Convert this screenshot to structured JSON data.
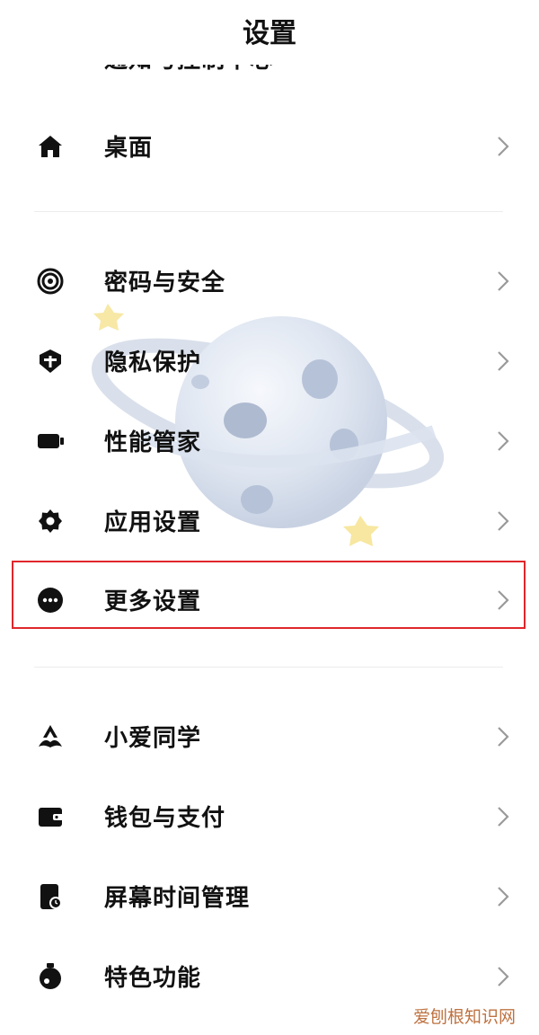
{
  "header": {
    "title": "设置"
  },
  "clipped_item": {
    "label": "通知与控制中心"
  },
  "groups": [
    {
      "items": [
        {
          "label": "桌面",
          "icon": "home-icon"
        }
      ]
    },
    {
      "items": [
        {
          "label": "密码与安全",
          "icon": "fingerprint-icon"
        },
        {
          "label": "隐私保护",
          "icon": "shield-icon"
        },
        {
          "label": "性能管家",
          "icon": "battery-icon"
        },
        {
          "label": "应用设置",
          "icon": "gear-icon"
        },
        {
          "label": "更多设置",
          "icon": "more-dots-icon",
          "highlighted": true
        }
      ]
    },
    {
      "items": [
        {
          "label": "小爱同学",
          "icon": "xiaoai-icon"
        },
        {
          "label": "钱包与支付",
          "icon": "wallet-icon"
        },
        {
          "label": "屏幕时间管理",
          "icon": "screen-time-icon"
        },
        {
          "label": "特色功能",
          "icon": "features-icon"
        }
      ]
    }
  ],
  "colors": {
    "highlight_border": "#e0262b",
    "text": "#111111",
    "chevron": "#9a9a9a",
    "divider": "#ececec"
  },
  "watermark": "爱刨根知识网"
}
